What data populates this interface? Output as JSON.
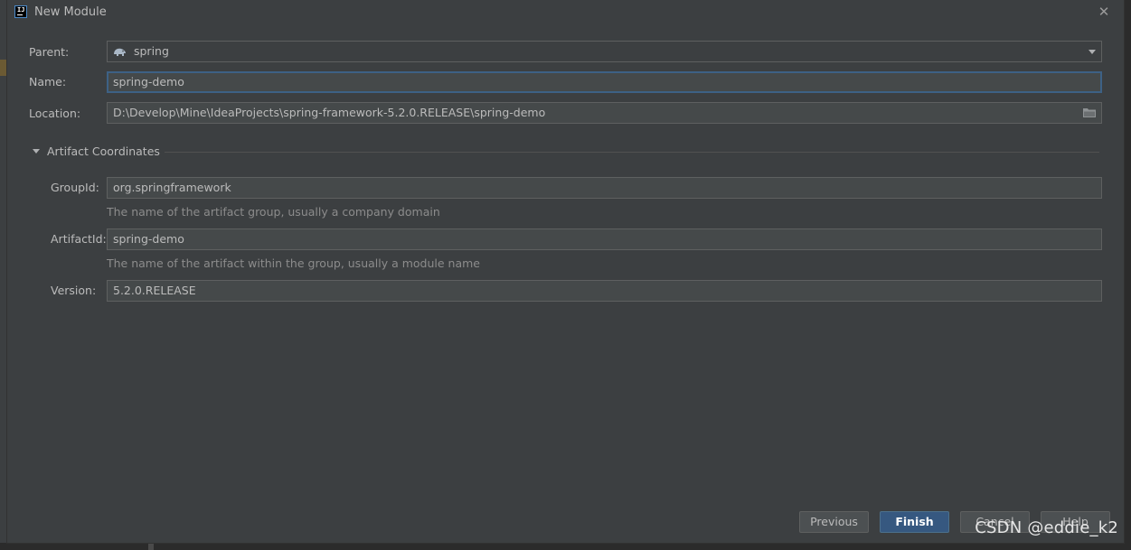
{
  "window": {
    "title": "New Module",
    "app_icon_text": "IJ"
  },
  "form": {
    "parent_label": "Parent:",
    "parent_value": "spring",
    "name_label": "Name:",
    "name_value": "spring-demo",
    "location_label": "Location:",
    "location_value": "D:\\Develop\\Mine\\IdeaProjects\\spring-framework-5.2.0.RELEASE\\spring-demo"
  },
  "artifact": {
    "section_title": "Artifact Coordinates",
    "groupid_label": "GroupId:",
    "groupid_value": "org.springframework",
    "groupid_hint": "The name of the artifact group, usually a company domain",
    "artifactid_label": "ArtifactId:",
    "artifactid_value": "spring-demo",
    "artifactid_hint": "The name of the artifact within the group, usually a module name",
    "version_label": "Version:",
    "version_value": "5.2.0.RELEASE"
  },
  "buttons": {
    "previous": "Previous",
    "finish": "Finish",
    "cancel": "Cancel",
    "help": "Help"
  },
  "watermark": "CSDN @eddie_k2",
  "colors": {
    "dialog_bg": "#3c3f41",
    "field_bg": "#45494a",
    "focus_border": "#3d6185",
    "primary_button": "#365880"
  },
  "icons": {
    "parent_icon": "gradle-elephant-icon",
    "location_browse": "folder-icon",
    "dropdown": "chevron-down-icon",
    "section_toggle": "triangle-down-icon",
    "close": "close-icon"
  }
}
